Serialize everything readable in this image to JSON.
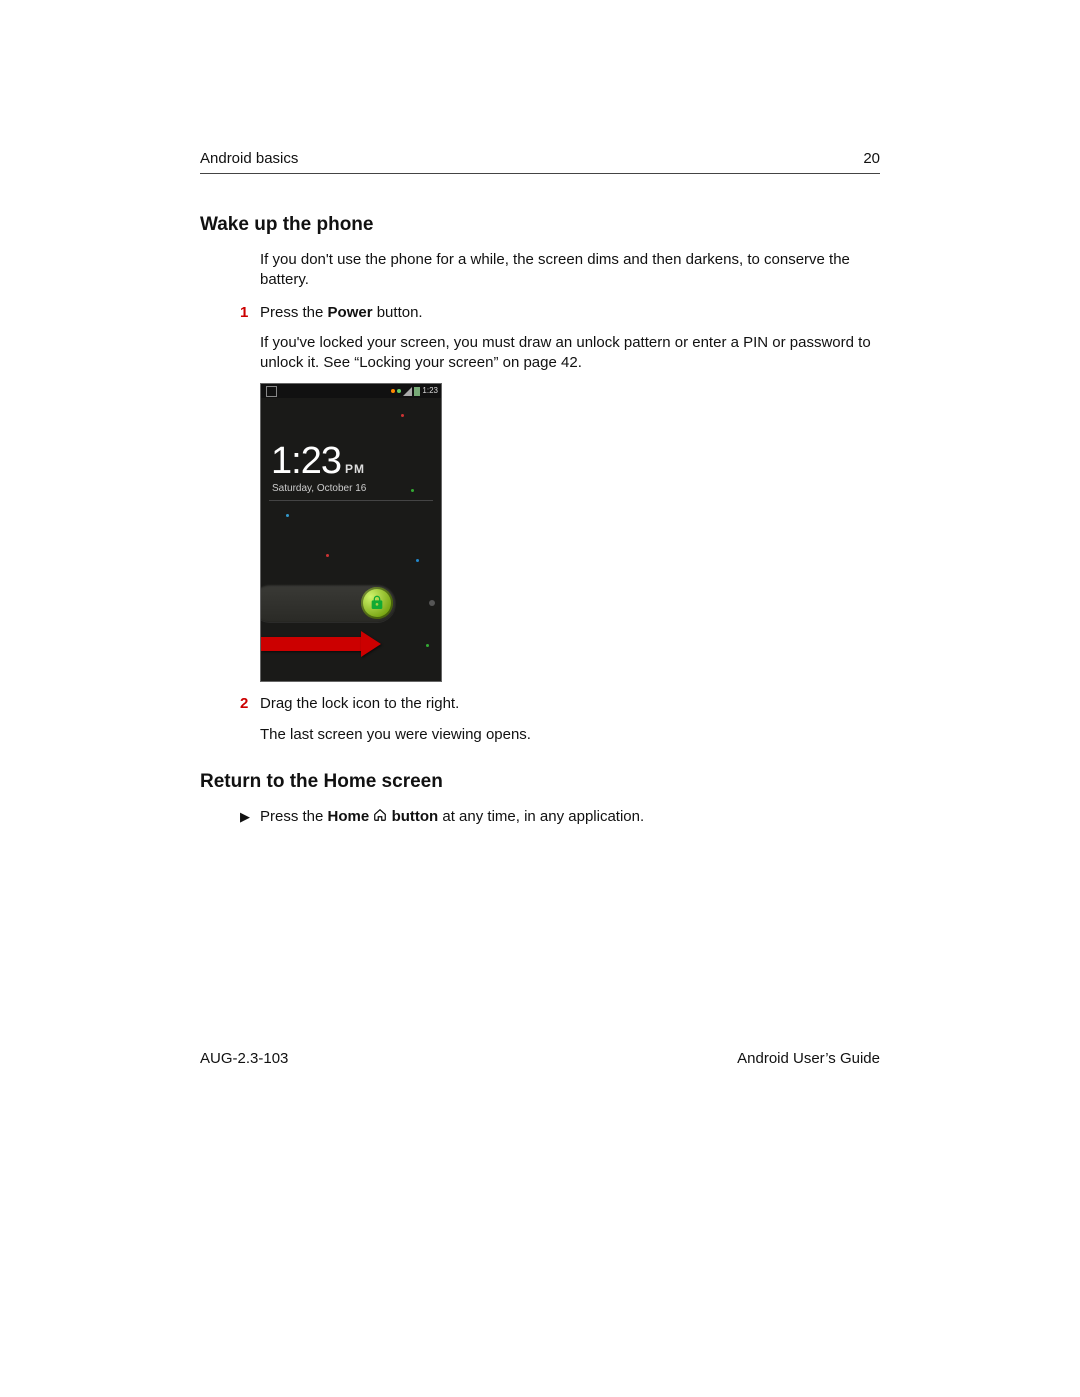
{
  "header": {
    "section": "Android basics",
    "page_number": "20"
  },
  "section1": {
    "title": "Wake up the phone",
    "intro": "If you don't use the phone for a while, the screen dims and then darkens, to conserve the battery.",
    "steps": [
      {
        "num": "1",
        "line_pre": "Press the ",
        "line_bold": "Power",
        "line_post": " button.",
        "para2": "If you've locked your screen, you must draw an unlock pattern or enter a PIN or password to unlock it. See “Locking your screen” on page 42."
      },
      {
        "num": "2",
        "line": "Drag the lock icon to the right.",
        "para2": "The last screen you were viewing opens."
      }
    ]
  },
  "phone": {
    "status_time": "1:23",
    "clock_time": "1:23",
    "clock_ampm": "PM",
    "clock_date": "Saturday, October 16"
  },
  "section2": {
    "title": "Return to the Home screen",
    "bullet_pre": "Press the ",
    "bullet_bold1": "Home",
    "bullet_mid": " ",
    "bullet_bold2": "button",
    "bullet_post": " at any time, in any application."
  },
  "footer": {
    "doc_id": "AUG-2.3-103",
    "doc_title": "Android User’s Guide"
  }
}
